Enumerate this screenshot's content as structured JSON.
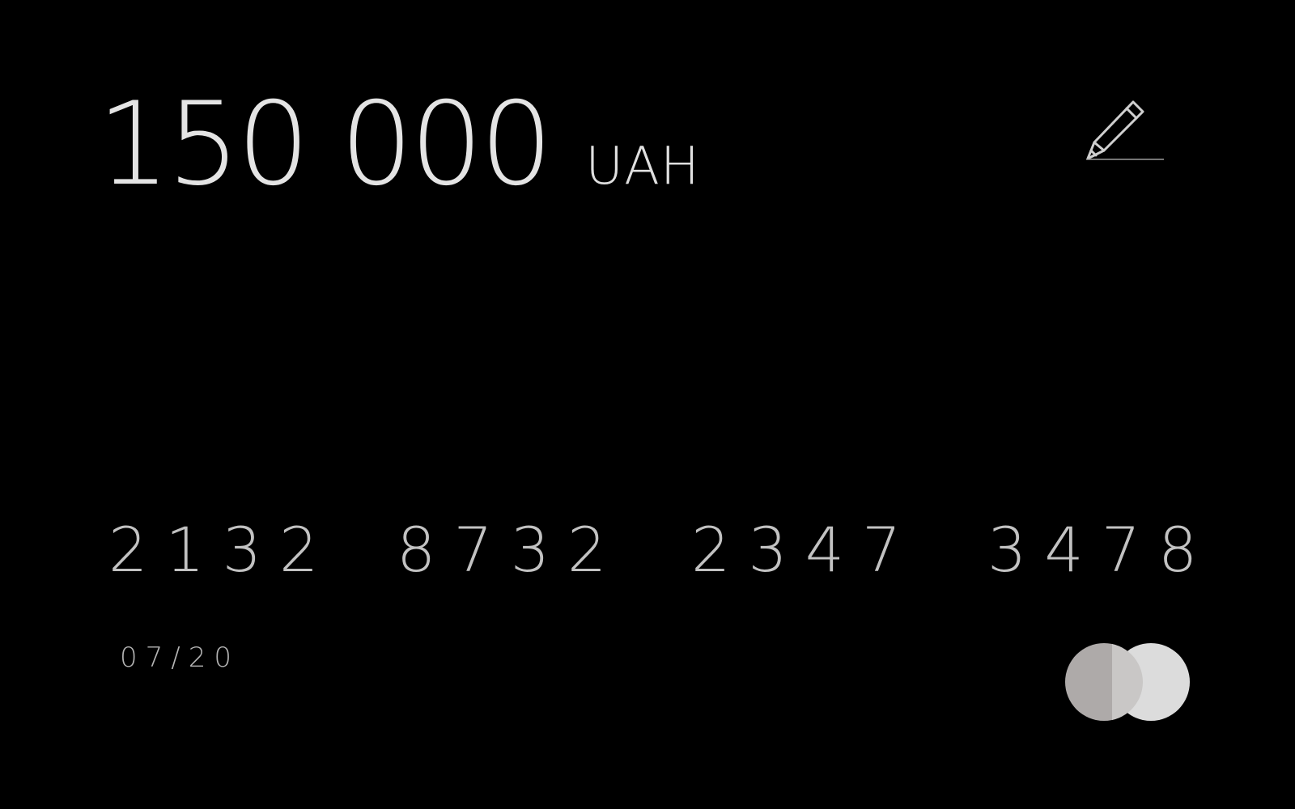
{
  "balance": {
    "amount": "150 000",
    "currency": "UAH"
  },
  "actions": {
    "edit_icon": "pencil-icon"
  },
  "card": {
    "number_groups": [
      "2132",
      "8732",
      "2347",
      "3478"
    ],
    "expiry": "07/20",
    "brand_logo": "mastercard-logo"
  },
  "colors": {
    "background": "#000000",
    "balance_text": "#e4e4e4",
    "number_text": "#c2c2c2",
    "logo_left": "#aeaaa9",
    "logo_right": "#dcdcdc"
  }
}
